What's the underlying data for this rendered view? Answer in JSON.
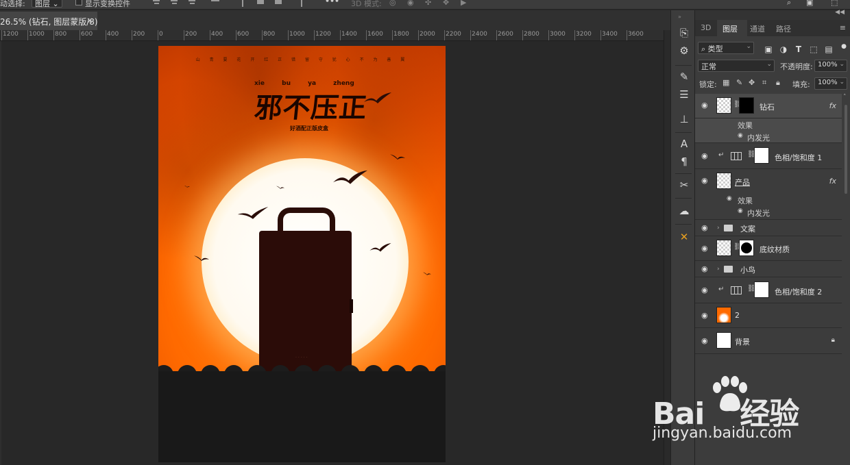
{
  "options_bar": {
    "auto_select_label": "动选择:",
    "auto_select_value": "图层",
    "show_transform_label": "显示变换控件",
    "more_label": "•••",
    "mode_3d_label": "3D 模式:"
  },
  "document_tab": {
    "title": "26.5% (钻石, 图层蒙版/8)",
    "close": "×"
  },
  "ruler": {
    "ticks": [
      "1200",
      "1000",
      "800",
      "600",
      "400",
      "200",
      "0",
      "200",
      "400",
      "600",
      "800",
      "1000",
      "1200",
      "1400",
      "1600",
      "1800",
      "2000",
      "2200",
      "2400",
      "2600",
      "2800",
      "3000",
      "3200",
      "3400",
      "3600"
    ]
  },
  "poster": {
    "top_line": "山 青 要 花 开 红 正 错 留 守 犹 心 不 为 善 翼",
    "pinyin": "xie bu ya zheng",
    "title": "邪不压正",
    "subtitle": "好酒配正版皮盒",
    "case_dots": "·····"
  },
  "panel": {
    "tabs": [
      "3D",
      "图层",
      "通道",
      "路径"
    ],
    "active_tab": "图层",
    "filter_kind": "类型",
    "blend_mode": "正常",
    "opacity_label": "不透明度:",
    "opacity_value": "100%",
    "lock_label": "锁定:",
    "fill_label": "填充:",
    "fill_value": "100%",
    "layers": [
      {
        "name": "钻石",
        "fx": "fx",
        "effects_label": "效果",
        "effect": "内发光"
      },
      {
        "name": "色相/饱和度 1"
      },
      {
        "name": "产品",
        "fx": "fx",
        "effects_label": "效果",
        "effect": "内发光"
      },
      {
        "name": "文案"
      },
      {
        "name": "底纹材质"
      },
      {
        "name": "小鸟"
      },
      {
        "name": "色相/饱和度 2"
      },
      {
        "name": "2"
      },
      {
        "name": "背景"
      }
    ]
  },
  "watermark": {
    "brand": "Bai",
    "brand_suffix": "经验",
    "url": "jingyan.baidu.com"
  },
  "colors": {
    "poster_orange": "#ff6a00",
    "ui_panel": "#3c3c3c",
    "ui_dark": "#282828"
  }
}
